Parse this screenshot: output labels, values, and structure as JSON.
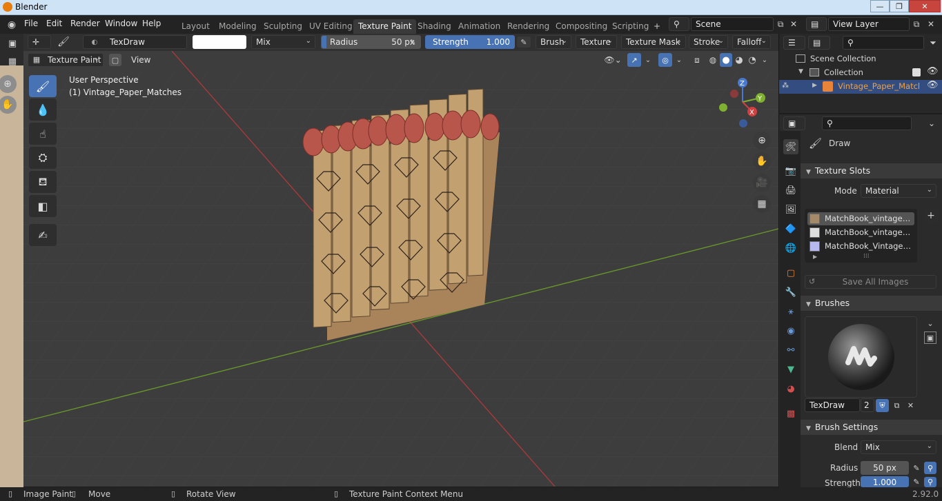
{
  "window": {
    "title": "Blender",
    "min": "—",
    "max": "❐",
    "close": "✕"
  },
  "menu": [
    "File",
    "Edit",
    "Render",
    "Window",
    "Help"
  ],
  "workspaces": [
    "Layout",
    "Modeling",
    "Sculpting",
    "UV Editing",
    "Texture Paint",
    "Shading",
    "Animation",
    "Rendering",
    "Compositing",
    "Scripting"
  ],
  "active_workspace": "Texture Paint",
  "add_tab": "+",
  "scene": {
    "value": "Scene"
  },
  "view_layer": {
    "value": "View Layer"
  },
  "tool_header": {
    "brush_name": "TexDraw",
    "blend": "Mix",
    "radius_label": "Radius",
    "radius_value": "50 px",
    "strength_label": "Strength",
    "strength_value": "1.000",
    "menus": [
      "Brush",
      "Texture",
      "Texture Mask",
      "Stroke",
      "Falloff"
    ]
  },
  "viewport_header": {
    "mode": "Texture Paint",
    "view_menu": "View"
  },
  "viewport": {
    "perspective": "User Perspective",
    "object_info": "(1) Vintage_Paper_Matches",
    "gizmo": {
      "z": "Z",
      "y": "Y",
      "x": "X"
    }
  },
  "outliner": {
    "scene_collection": "Scene Collection",
    "collection": "Collection",
    "object": "Vintage_Paper_Matcl"
  },
  "properties": {
    "tool_name": "Draw",
    "texture_slots": {
      "title": "Texture Slots",
      "mode_label": "Mode",
      "mode_value": "Material",
      "slots": [
        "MatchBook_vintage_diff...",
        "MatchBook_vintage_sp...",
        "MatchBook_Vintage_no..."
      ],
      "save_all": "Save All Images"
    },
    "brushes": {
      "title": "Brushes",
      "brush_name": "TexDraw",
      "users": "2"
    },
    "brush_settings": {
      "title": "Brush Settings",
      "blend_label": "Blend",
      "blend_value": "Mix",
      "radius_label": "Radius",
      "radius_value": "50 px",
      "strength_label": "Strength",
      "strength_value": "1.000"
    }
  },
  "status": {
    "image_paint": "Image Paint",
    "move": "Move",
    "rotate_view": "Rotate View",
    "context_menu": "Texture Paint Context Menu",
    "version": "2.92.0"
  },
  "colors": {
    "accent": "#4772b3",
    "match_head": "#b8564c",
    "match_stick": "#b08a5c",
    "grid_red": "#b03a3a",
    "grid_green": "#6a9a2a"
  }
}
